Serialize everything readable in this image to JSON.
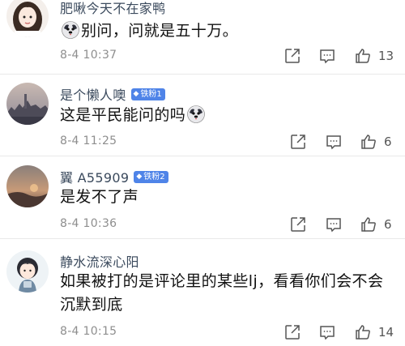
{
  "comments": [
    {
      "username": "肥啾今天不在家鸭",
      "badge": "",
      "text_before": "",
      "text_after": "别问，问就是五十万。",
      "emoji_position": "before",
      "time": "8-4 10:37",
      "likes": "13",
      "avatar": "girl-illustration"
    },
    {
      "username": "是个懒人噢",
      "badge": "铁粉1",
      "text_before": "这是平民能问的吗",
      "text_after": "",
      "emoji_position": "after",
      "time": "8-4 11:25",
      "likes": "6",
      "avatar": "city-landscape"
    },
    {
      "username": "翼 A55909",
      "badge": "铁粉2",
      "text_before": "是发不了声",
      "text_after": "",
      "emoji_position": "none",
      "time": "8-4 10:36",
      "likes": "6",
      "avatar": "sunset-landscape"
    },
    {
      "username": "静水流深心阳",
      "badge": "",
      "text_before": "如果被打的是评论里的某些lj，看看你们会不会沉默到底",
      "text_after": "",
      "emoji_position": "none",
      "time": "8-4 10:15",
      "likes": "14",
      "avatar": "boy-illustration"
    }
  ],
  "icons": {
    "share": "share-icon",
    "comment": "comment-icon",
    "like": "thumbs-up-icon",
    "emoji": "doge-face-emoji",
    "badge": "diamond-icon"
  },
  "colors": {
    "username": "#3b4a5d",
    "badge": "#4f84e8",
    "time": "#8e8e8e",
    "text": "#111111"
  }
}
